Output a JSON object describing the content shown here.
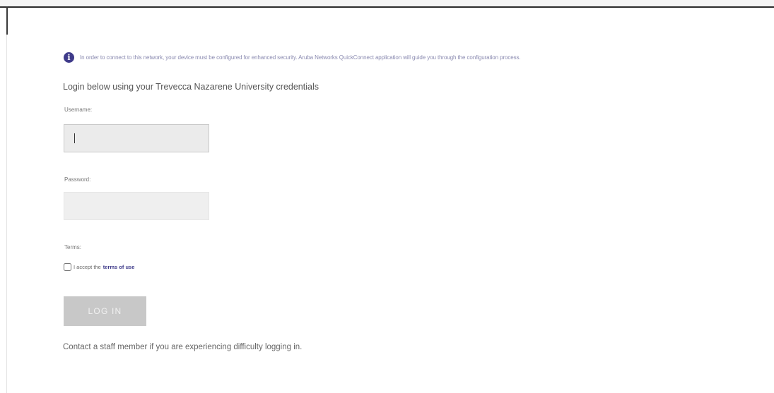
{
  "colors": {
    "accent": "#3f3b8a",
    "info_text": "#8a8ab0",
    "button_disabled_bg": "#c8c8c8",
    "input_bg": "#efefef"
  },
  "info": {
    "icon": "info-icon",
    "icon_glyph": "i",
    "text": "In order to connect to this network, your device must be configured for enhanced security. Aruba Networks QuickConnect application will guide you through the configuration process."
  },
  "login": {
    "heading": "Login below using your Trevecca Nazarene University credentials",
    "username_label": "Username:",
    "username_value": "",
    "password_label": "Password:",
    "password_value": "",
    "terms_label": "Terms:",
    "accept_text": "I accept the",
    "terms_link": "terms of use",
    "terms_checked": false,
    "button_label": "LOG IN",
    "button_enabled": false,
    "help_text": "Contact a staff member if you are experiencing difficulty logging in."
  }
}
